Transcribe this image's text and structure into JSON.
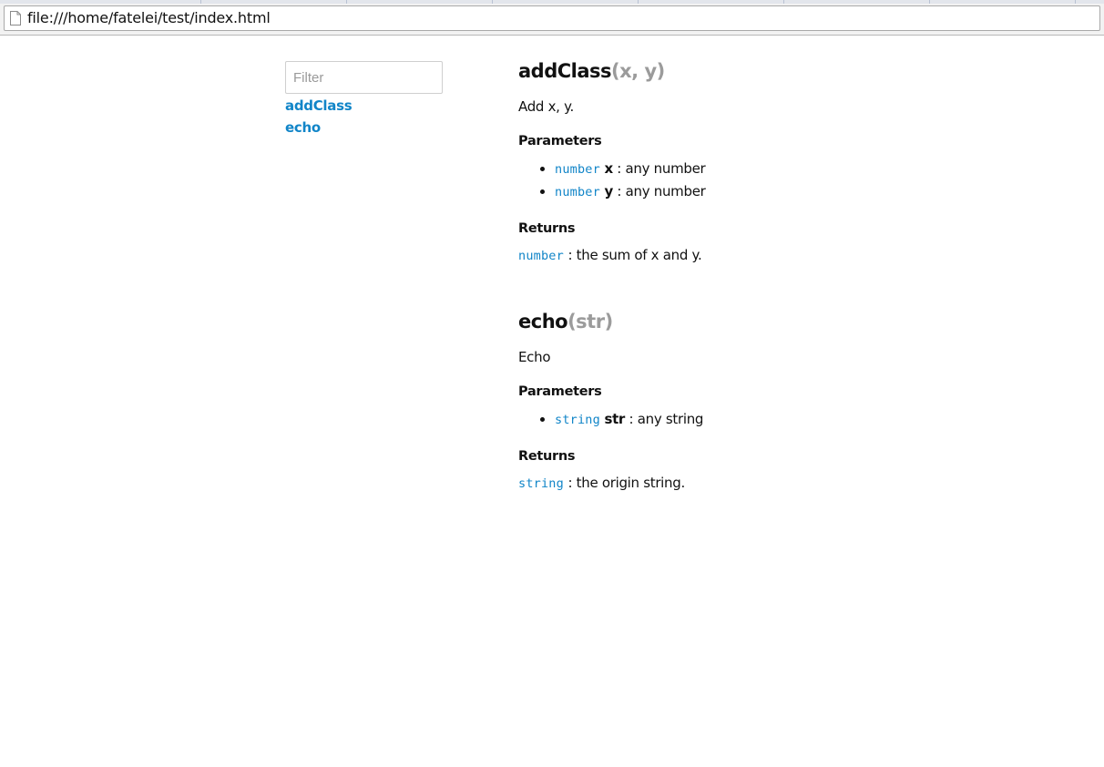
{
  "browser": {
    "url": "file:///home/fatelei/test/index.html"
  },
  "sidebar": {
    "filter_placeholder": "Filter",
    "filter_value": "",
    "items": [
      {
        "label": "addClass"
      },
      {
        "label": "echo"
      }
    ]
  },
  "main": {
    "functions": [
      {
        "name": "addClass",
        "signature": "(x, y)",
        "description": "Add x, y.",
        "params_heading": "Parameters",
        "params": [
          {
            "type": "number",
            "name": "x",
            "desc": ": any number"
          },
          {
            "type": "number",
            "name": "y",
            "desc": ": any number"
          }
        ],
        "returns_heading": "Returns",
        "returns": {
          "type": "number",
          "desc": ": the sum of x and y."
        }
      },
      {
        "name": "echo",
        "signature": "(str)",
        "description": "Echo",
        "params_heading": "Parameters",
        "params": [
          {
            "type": "string",
            "name": "str",
            "desc": ": any string"
          }
        ],
        "returns_heading": "Returns",
        "returns": {
          "type": "string",
          "desc": ": the origin string."
        }
      }
    ]
  },
  "colors": {
    "link": "#1185c8",
    "signature": "#9b9b9b",
    "text": "#111111"
  },
  "icons": {
    "page": "page-icon"
  }
}
